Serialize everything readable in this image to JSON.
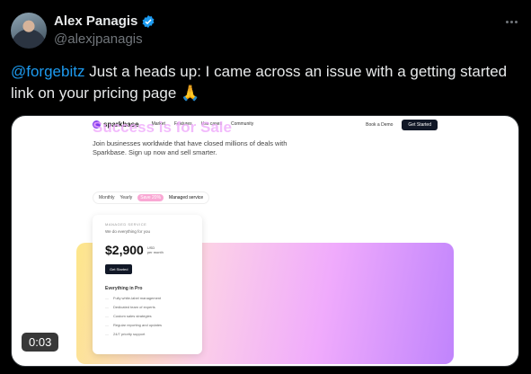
{
  "author": {
    "name": "Alex Panagis",
    "handle": "@alexjpanagis"
  },
  "tweet": {
    "mention": "@forgebitz",
    "text": " Just a heads up: I came across an issue with a getting started link on your pricing page ",
    "emoji": "🙏"
  },
  "media": {
    "timer": "0:03",
    "site": {
      "logo": "sparkbase",
      "nav_links": [
        "Market",
        "Features",
        "Use cases",
        "Community"
      ],
      "book_demo": "Book a Demo",
      "get_started": "Get Started",
      "hero_title": "Success is for Sale",
      "hero_subtitle": "Join businesses worldwide that have closed millions of deals with Sparkbase. Sign up now and sell smarter.",
      "billing": {
        "monthly": "Monthly",
        "yearly": "Yearly",
        "discount": "Save 20%",
        "managed": "Managed service"
      },
      "plan": {
        "label": "MANAGED SERVICE",
        "tagline": "We do everything for you",
        "price": "$2,900",
        "unit_line1": "USD",
        "unit_line2": "per month",
        "button": "Get Started",
        "features_title": "Everything in Pro",
        "features": [
          "Fully white-label management",
          "Dedicated team of experts",
          "Custom sales strategies",
          "Regular reporting and updates",
          "24/7 priority support"
        ]
      }
    }
  }
}
